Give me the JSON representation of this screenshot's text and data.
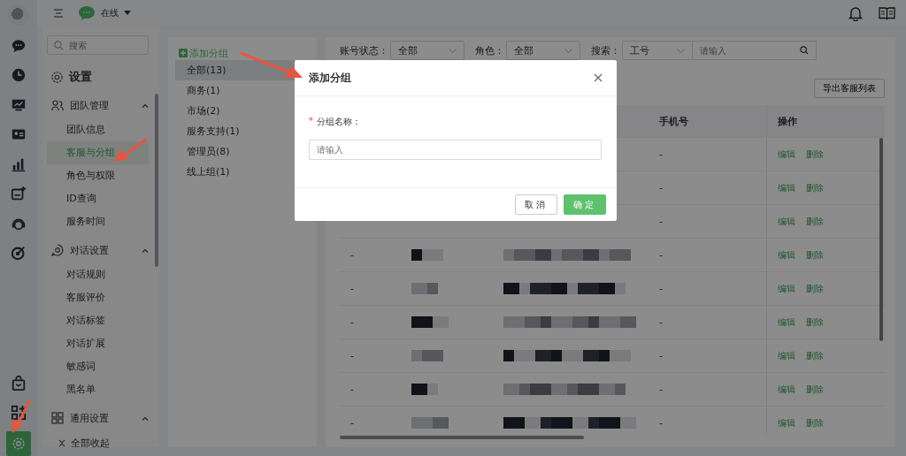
{
  "rail": {
    "items": [
      {
        "kind": "chat",
        "selected": false
      },
      {
        "kind": "clock",
        "selected": false
      },
      {
        "kind": "monitor",
        "selected": false
      },
      {
        "kind": "card",
        "selected": false
      },
      {
        "kind": "chart",
        "selected": false
      },
      {
        "kind": "addcard",
        "selected": false
      },
      {
        "kind": "ai",
        "selected": false
      },
      {
        "kind": "target",
        "selected": false
      }
    ],
    "bottom": [
      {
        "kind": "bag",
        "selected": false
      },
      {
        "kind": "apps",
        "selected": false
      },
      {
        "kind": "settings",
        "selected": true
      }
    ]
  },
  "topbar": {
    "status": "在线"
  },
  "settings_nav": {
    "search_placeholder": "搜索",
    "title": "设置",
    "sections": [
      {
        "label": "团队管理",
        "kind": "team",
        "expanded": true,
        "children": [
          {
            "label": "团队信息",
            "selected": false
          },
          {
            "label": "客服与分组",
            "selected": true
          },
          {
            "label": "角色与权限",
            "selected": false
          },
          {
            "label": "ID查询",
            "selected": false
          },
          {
            "label": "服务时间",
            "selected": false
          }
        ]
      },
      {
        "label": "对话设置",
        "kind": "chat",
        "expanded": true,
        "children": [
          {
            "label": "对话规则",
            "selected": false
          },
          {
            "label": "客服评价",
            "selected": false
          },
          {
            "label": "对话标签",
            "selected": false
          },
          {
            "label": "对话扩展",
            "selected": false
          },
          {
            "label": "敏感词",
            "selected": false
          },
          {
            "label": "黑名单",
            "selected": false
          }
        ]
      },
      {
        "label": "通用设置",
        "kind": "grid",
        "expanded": true
      }
    ],
    "collapse_all": "全部收起"
  },
  "groups": {
    "add_label": "添加分组",
    "items": [
      {
        "label": "全部(13)",
        "selected": true
      },
      {
        "label": "商务(1)",
        "selected": false
      },
      {
        "label": "市场(2)",
        "selected": false
      },
      {
        "label": "服务支持(1)",
        "selected": false
      },
      {
        "label": "管理员(8)",
        "selected": false
      },
      {
        "label": "线上组(1)",
        "selected": false
      }
    ]
  },
  "filters": [
    {
      "label": "账号状态：",
      "value": "全部"
    },
    {
      "label": "角色：",
      "value": "全部"
    },
    {
      "label": "搜索：",
      "value": "工号",
      "placeholder": "请输入"
    }
  ],
  "export_button": "导出客服列表",
  "table": {
    "columns": [
      "手机号",
      "操作"
    ],
    "rows": [
      {
        "phone": "-",
        "actions": [
          "编辑",
          "删除"
        ]
      },
      {
        "phone": "-",
        "actions": [
          "编辑",
          "删除"
        ]
      },
      {
        "phone": "-",
        "actions": [
          "编辑",
          "删除"
        ]
      },
      {
        "column_1": "-",
        "redacted": true,
        "phone": "-",
        "actions": [
          "编辑",
          "删除"
        ]
      },
      {
        "column_1": "-",
        "redacted": true,
        "phone": "-",
        "actions": [
          "编辑",
          "删除"
        ]
      },
      {
        "column_1": "-",
        "redacted": true,
        "phone": "-",
        "actions": [
          "编辑",
          "删除"
        ]
      },
      {
        "column_1": "-",
        "redacted": true,
        "phone": "-",
        "actions": [
          "编辑",
          "删除"
        ]
      },
      {
        "column_1": "-",
        "redacted": true,
        "phone": "-",
        "actions": [
          "编辑",
          "删除"
        ]
      },
      {
        "column_1": "-",
        "redacted": true,
        "phone": "-",
        "actions": [
          "编辑",
          "删除"
        ]
      }
    ]
  },
  "modal": {
    "title": "添加分组",
    "field_label": "分组名称：",
    "required_mark": "*",
    "placeholder": "请输入",
    "buttons": [
      {
        "label": "取消",
        "kind": "default"
      },
      {
        "label": "确定",
        "kind": "primary"
      }
    ]
  }
}
